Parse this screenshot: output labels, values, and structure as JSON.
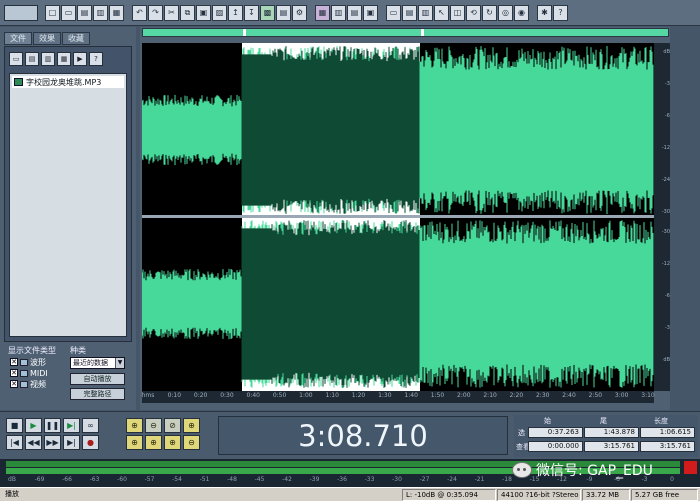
{
  "toolbar": {
    "buttons": [
      "new-file",
      "open-file",
      "save-file",
      "close-file",
      "undo",
      "redo",
      "cut",
      "copy",
      "paste",
      "mix-paste",
      "trim",
      "silence",
      "zoom",
      "select-all",
      "spectrum",
      "settings",
      "grid",
      "bars",
      "split",
      "normal",
      "play",
      "loop",
      "repeat",
      "cd",
      "record",
      "tools",
      "help"
    ]
  },
  "left_panel": {
    "tabs": [
      "文件",
      "效果",
      "收藏"
    ],
    "files": [
      "字校园龙奥堆跳.MP3"
    ],
    "file_type_label": "显示文件类型",
    "sort_label": "种类",
    "file_types": [
      {
        "label": "波形",
        "checked": true
      },
      {
        "label": "MIDI",
        "checked": true
      },
      {
        "label": "视频",
        "checked": true
      }
    ],
    "sort_value": "最近的数据",
    "buttons": [
      "自动播放",
      "完整路径"
    ]
  },
  "waveform": {
    "time_ticks": [
      "hms",
      "0:10",
      "0:20",
      "0:30",
      "0:40",
      "0:50",
      "1:00",
      "1:10",
      "1:20",
      "1:30",
      "1:40",
      "1:50",
      "2:00",
      "2:10",
      "2:20",
      "2:30",
      "2:40",
      "2:50",
      "3:00",
      "3:10"
    ],
    "db_ticks_top": [
      "dB",
      "-3",
      "-6",
      "-12",
      "-24",
      "-30"
    ],
    "db_ticks_bottom": [
      "-30",
      "-12",
      "-6",
      "-3",
      "dB"
    ]
  },
  "transport": {
    "time": "3:08.710"
  },
  "selection": {
    "headers": [
      "始",
      "尾",
      "长度"
    ],
    "rows": [
      {
        "label": "选",
        "values": [
          "0:37.263",
          "1:43.878",
          "1:06.615"
        ]
      },
      {
        "label": "查看",
        "values": [
          "0:00.000",
          "3:15.761",
          "3:15.761"
        ]
      }
    ]
  },
  "meter": {
    "ticks": [
      "dB",
      "-69",
      "-66",
      "-63",
      "-60",
      "-57",
      "-54",
      "-51",
      "-48",
      "-45",
      "-42",
      "-39",
      "-36",
      "-33",
      "-30",
      "-27",
      "-24",
      "-21",
      "-18",
      "-15",
      "-12",
      "-9",
      "-6",
      "-3",
      "0"
    ]
  },
  "watermark": "微信号: GAP_EDU",
  "status": {
    "state": "播放",
    "cursor": "L: -10dB @ 0:35.094",
    "format": "44100 ?16-bit ?Stereo",
    "size": "33.72 MB",
    "free": "5.27 GB free"
  },
  "colors": {
    "wave_selected": "#0f4a34",
    "wave_unselected": "#47d99a",
    "wave_background": "#000000"
  }
}
